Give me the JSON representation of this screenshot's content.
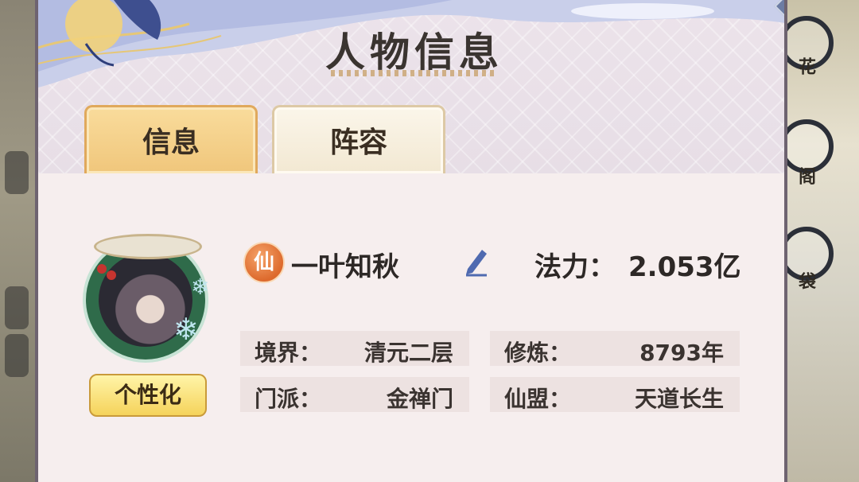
{
  "header": {
    "title": "人物信息"
  },
  "tabs": [
    {
      "label": "信息",
      "active": true
    },
    {
      "label": "阵容",
      "active": false
    }
  ],
  "background_right_labels": [
    "花",
    "阁",
    "袋"
  ],
  "profile": {
    "title_badge": "仙",
    "name": "一叶知秋",
    "power_label": "法力：",
    "power_value": "2.053亿",
    "personalize_label": "个性化"
  },
  "stats": [
    {
      "label": "境界：",
      "value": "清元二层"
    },
    {
      "label": "修炼：",
      "value": "8793年"
    },
    {
      "label": "门派：",
      "value": "金禅门"
    },
    {
      "label": "仙盟：",
      "value": "天道长生"
    }
  ],
  "colors": {
    "tab_active": "#f0c67b",
    "tab_inactive": "#f2e8d2",
    "badge": "#dd6a2d",
    "edit_icon": "#4f6ab0",
    "avatar_frame": "#2f6b4a"
  },
  "icons": [
    "close-icon",
    "edit-pencil-icon",
    "snowflake-icon"
  ]
}
